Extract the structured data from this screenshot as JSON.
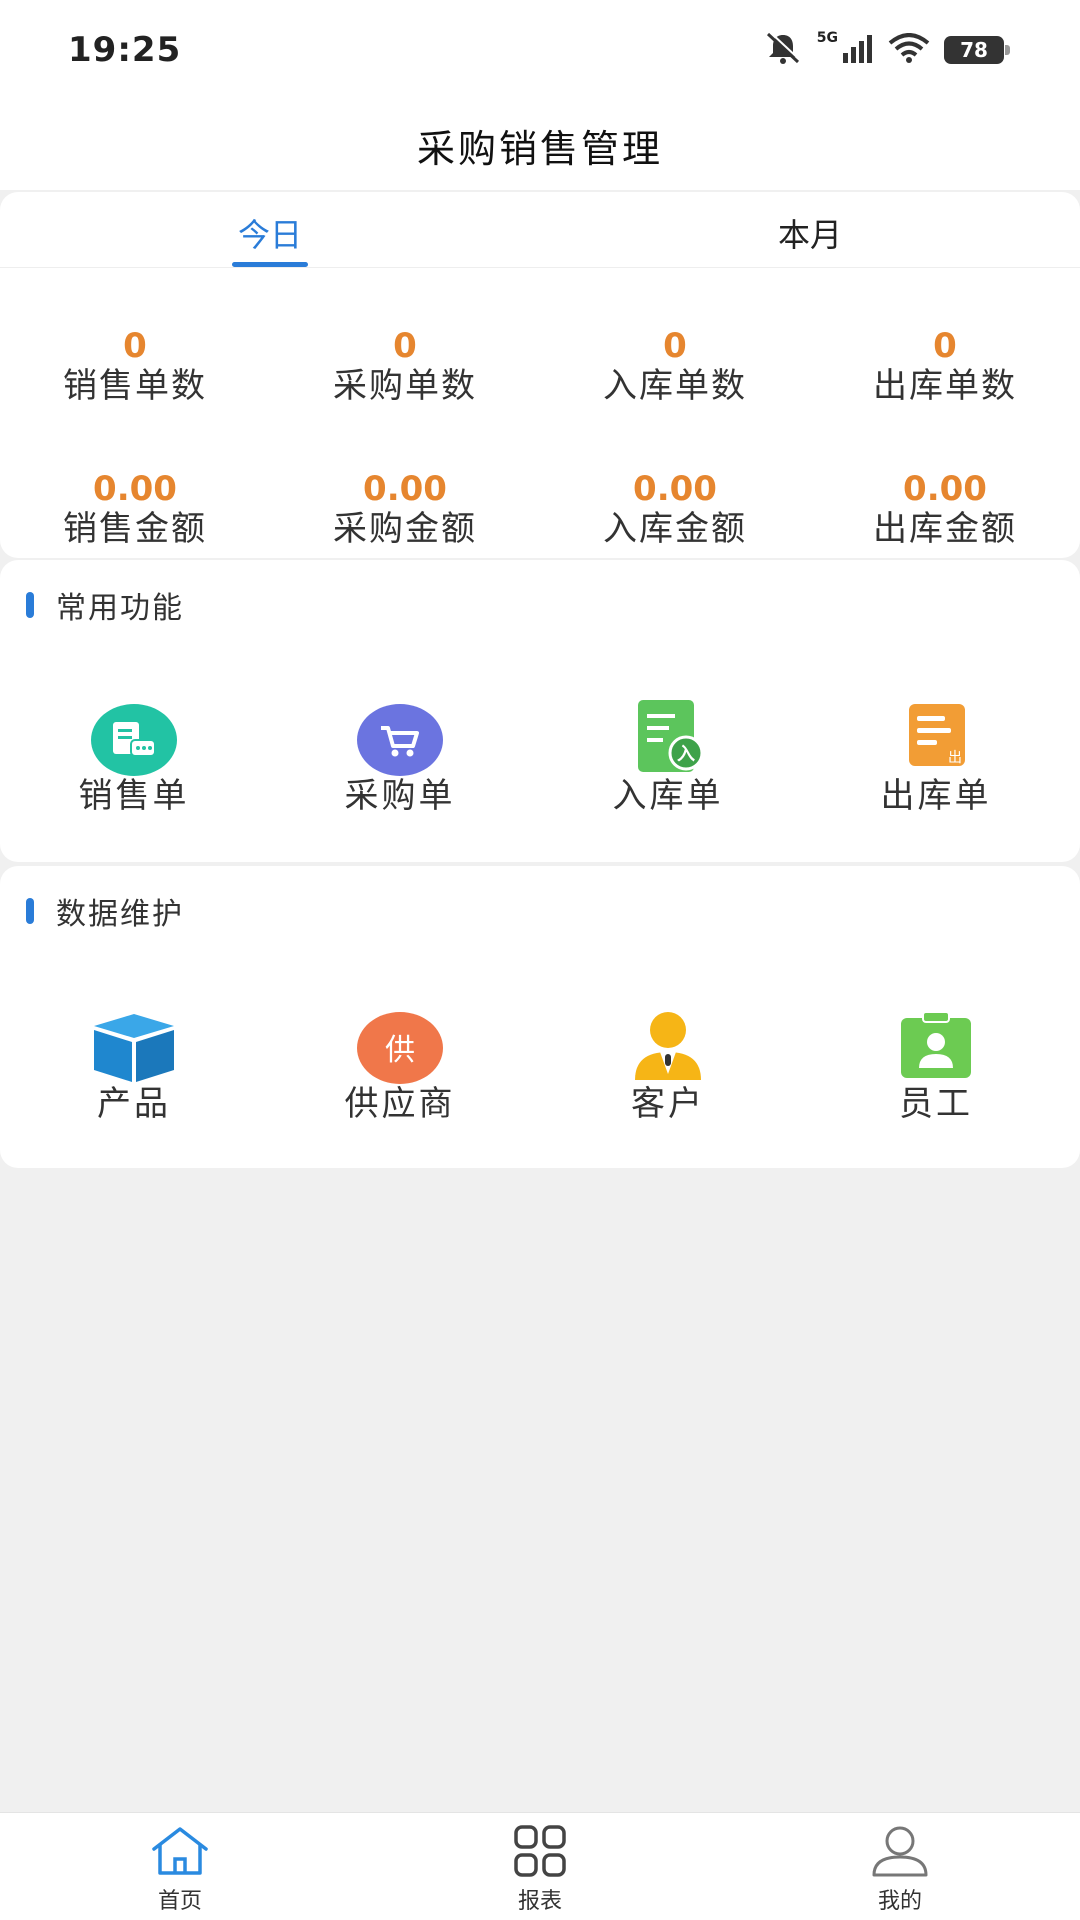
{
  "status_bar": {
    "time": "19:25",
    "network": "5G",
    "battery": "78",
    "icons": [
      "mute-icon",
      "signal-icon",
      "wifi-icon",
      "battery-icon"
    ]
  },
  "header": {
    "title": "采购销售管理"
  },
  "tabs": [
    {
      "label": "今日",
      "active": true
    },
    {
      "label": "本月",
      "active": false
    }
  ],
  "stats": {
    "counts": [
      {
        "value": "0",
        "label": "销售单数"
      },
      {
        "value": "0",
        "label": "采购单数"
      },
      {
        "value": "0",
        "label": "入库单数"
      },
      {
        "value": "0",
        "label": "出库单数"
      }
    ],
    "amounts": [
      {
        "value": "0.00",
        "label": "销售金额"
      },
      {
        "value": "0.00",
        "label": "采购金额"
      },
      {
        "value": "0.00",
        "label": "入库金额"
      },
      {
        "value": "0.00",
        "label": "出库金额"
      }
    ]
  },
  "common_functions": {
    "title": "常用功能",
    "items": [
      {
        "label": "销售单",
        "icon": "sales-order-icon"
      },
      {
        "label": "采购单",
        "icon": "purchase-cart-icon"
      },
      {
        "label": "入库单",
        "icon": "inbound-doc-icon",
        "badge": "入"
      },
      {
        "label": "出库单",
        "icon": "outbound-doc-icon",
        "badge": "出"
      }
    ]
  },
  "data_maintenance": {
    "title": "数据维护",
    "items": [
      {
        "label": "产品",
        "icon": "box-icon"
      },
      {
        "label": "供应商",
        "icon": "supplier-icon",
        "badge": "供"
      },
      {
        "label": "客户",
        "icon": "customer-icon"
      },
      {
        "label": "员工",
        "icon": "employee-badge-icon"
      }
    ]
  },
  "bottom_nav": [
    {
      "label": "首页",
      "icon": "home-icon",
      "active": true
    },
    {
      "label": "报表",
      "icon": "grid-icon",
      "active": false
    },
    {
      "label": "我的",
      "icon": "user-icon",
      "active": false
    }
  ],
  "colors": {
    "accent": "#2a7cd8",
    "stat_value": "#e6862f",
    "background": "#f0f0f0"
  }
}
